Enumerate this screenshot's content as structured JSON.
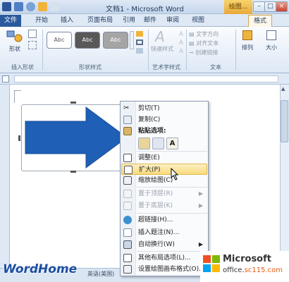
{
  "window": {
    "title": "文档1 - Microsoft Word",
    "drawing_tools_tab": "绘图...",
    "controls": [
      "–",
      "□",
      "×"
    ]
  },
  "ribbon_tabs": [
    "文件",
    "开始",
    "插入",
    "页面布局",
    "引用",
    "邮件",
    "审阅",
    "视图",
    "格式"
  ],
  "ribbon": {
    "insert_shapes": {
      "shapes_label": "形状",
      "group_label": "插入形状"
    },
    "shape_styles": {
      "swatches": [
        "Abc",
        "Abc",
        "Abc"
      ],
      "group_label": "形状样式"
    },
    "art_styles": {
      "quick_styles": "快速样式",
      "group_label": "艺术字样式"
    },
    "text": {
      "items": [
        "文字方向",
        "对齐文本",
        "创建链接"
      ],
      "group_label": "文本"
    },
    "arrange": {
      "label": "排列"
    },
    "size": {
      "label": "大小"
    }
  },
  "context_menu": {
    "items": [
      {
        "label": "剪切(T)",
        "icon": "scissors-icon",
        "state": "normal"
      },
      {
        "label": "复制(C)",
        "icon": "copy-icon",
        "state": "normal"
      },
      {
        "label": "粘贴选项:",
        "icon": "paste-icon",
        "state": "header"
      },
      {
        "label": "调整(E)",
        "icon": "adjust-icon",
        "state": "normal"
      },
      {
        "label": "扩大(P)",
        "icon": "expand-icon",
        "state": "hover"
      },
      {
        "label": "缩放绘图(C)",
        "icon": "scale-drawing-icon",
        "state": "normal"
      },
      {
        "label": "置于顶层(R)",
        "icon": "bring-front-icon",
        "state": "disabled",
        "submenu": true
      },
      {
        "label": "置于底层(K)",
        "icon": "send-back-icon",
        "state": "disabled",
        "submenu": true
      },
      {
        "label": "超链接(H)...",
        "icon": "hyperlink-icon",
        "state": "normal"
      },
      {
        "label": "插入题注(N)...",
        "icon": "caption-icon",
        "state": "normal"
      },
      {
        "label": "自动换行(W)",
        "icon": "wrap-icon",
        "state": "normal",
        "submenu": true
      },
      {
        "label": "其他布局选项(L)...",
        "icon": "layout-icon",
        "state": "normal"
      },
      {
        "label": "设置绘图画布格式(O)...",
        "icon": "format-canvas-icon",
        "state": "normal"
      }
    ],
    "paste_buttons": [
      "",
      "",
      "A"
    ]
  },
  "status": {
    "language": "英语(美国)"
  },
  "watermarks": {
    "left": "WordHome",
    "brand": "Microsoft",
    "site_prefix": "office.",
    "site_domain": "sc115.com"
  },
  "colors": {
    "arrow_fill": "#1f5fb5",
    "hover": "#f8da7d",
    "ribbon": "#dde8f5"
  }
}
